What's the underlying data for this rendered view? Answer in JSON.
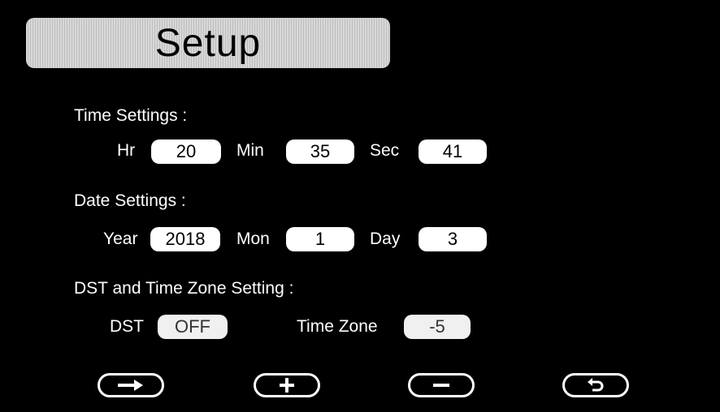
{
  "title": "Setup",
  "time": {
    "label": "Time Settings :",
    "hr_label": "Hr",
    "hr_value": "20",
    "min_label": "Min",
    "min_value": "35",
    "sec_label": "Sec",
    "sec_value": "41"
  },
  "date": {
    "label": "Date Settings :",
    "year_label": "Year",
    "year_value": "2018",
    "mon_label": "Mon",
    "mon_value": "1",
    "day_label": "Day",
    "day_value": "3"
  },
  "dst": {
    "label": "DST and Time Zone Setting :",
    "dst_label": "DST",
    "dst_value": "OFF",
    "tz_label": "Time Zone",
    "tz_value": "-5"
  },
  "buttons": [
    {
      "icon": "arrow-right-icon"
    },
    {
      "icon": "plus-icon"
    },
    {
      "icon": "minus-icon"
    },
    {
      "icon": "back-icon"
    }
  ]
}
